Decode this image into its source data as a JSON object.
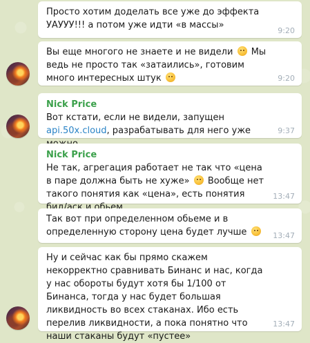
{
  "messages": [
    {
      "id": 1,
      "has_avatar": false,
      "sender": "",
      "text_parts": [
        "Просто хотим доделать все уже до эффекта УАУУУ!!! а потом уже идти «в массы»"
      ],
      "time": "9:20"
    },
    {
      "id": 2,
      "has_avatar": true,
      "sender": "",
      "text_parts": [
        "Вы еще многого не знаете и не видели",
        "Мы ведь не просто так «затаились», готовим много интересных штук"
      ],
      "emoji": [
        "winking-face-emoji",
        "winking-face-emoji"
      ],
      "time": "9:20"
    },
    {
      "id": 3,
      "has_avatar": true,
      "sender": "Nick Price",
      "text_parts": [
        "Вот кстати, если не видели, запущен ",
        "api.50x.cloud",
        ", разрабатывать для него уже можно."
      ],
      "time": "9:37"
    },
    {
      "id": 4,
      "has_avatar": false,
      "sender": "Nick Price",
      "text_parts": [
        "Не так, агрегация работает не так что «цена в паре должна быть не хуже»",
        "Вообще нет такого понятия как «цена», есть понятия бид/аск и обьем."
      ],
      "emoji": [
        "smiling-face-emoji"
      ],
      "time": "13:47"
    },
    {
      "id": 5,
      "has_avatar": false,
      "sender": "",
      "text_parts": [
        "Так вот при определенном обьеме и в определенную сторону цена будет лучше"
      ],
      "emoji": [
        "smiling-face-emoji"
      ],
      "time": "13:47"
    },
    {
      "id": 6,
      "has_avatar": true,
      "sender": "",
      "text_parts": [
        "Ну и сейчас как бы прямо скажем некорректно сравнивать Бинанс и нас, когда у нас обороты будут хотя бы 1/100 от Бинанса, тогда у нас будет большая ликвидность во всех стаканах. Ибо есть перелив ликвидности, а пока понятно что наши стаканы будут «пустее»"
      ],
      "time": "13:47"
    }
  ]
}
